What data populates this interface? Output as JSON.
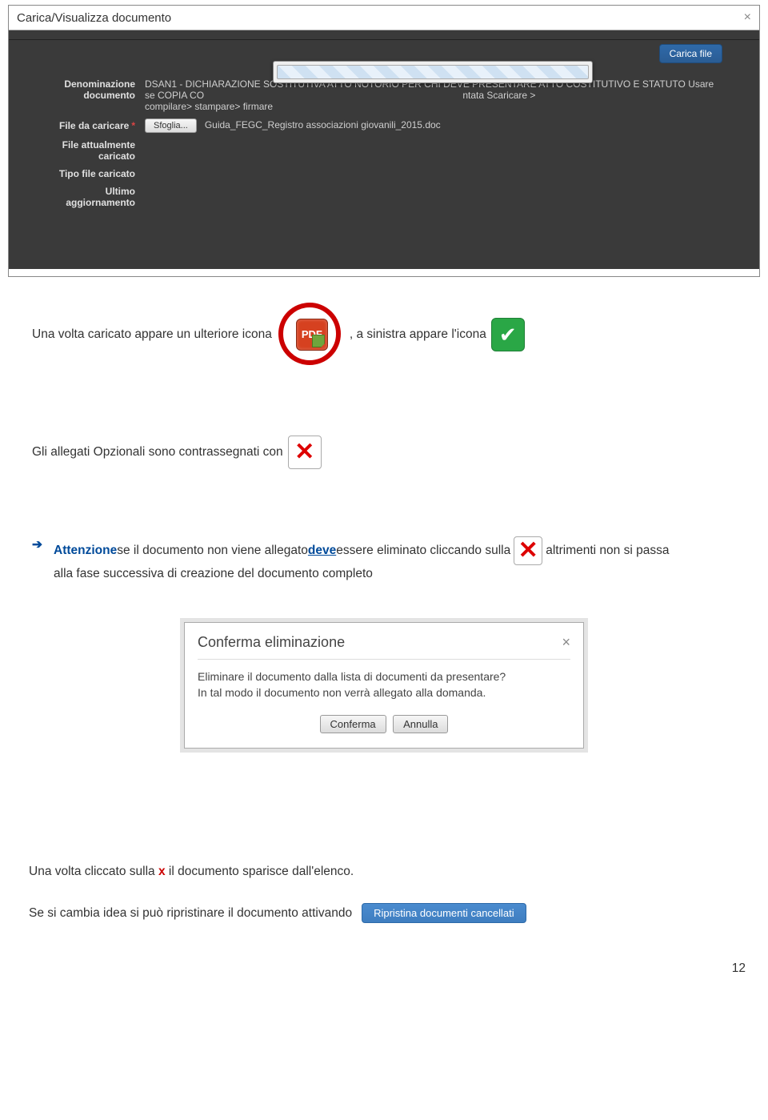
{
  "modal": {
    "title": "Carica/Visualizza documento",
    "close": "×",
    "upload_btn": "Carica file",
    "rows": {
      "name_label": "Denominazione documento",
      "name_value": "DSAN1 - DICHIARAZIONE SOSTITUTIVA ATTO NOTORIO PER CHI DEVE PRESENTARE ATTO COSTITUTIVO E STATUTO Usare se COPIA CO",
      "name_value2": "ntata Scaricare >",
      "name_value3": "compilare> stampare> firmare",
      "file_label": "File da caricare",
      "browse_btn": "Sfoglia...",
      "file_name": "Guida_FEGC_Registro associazioni giovanili_2015.doc",
      "current_label": "File attualmente caricato",
      "type_label": "Tipo file caricato",
      "updated_label": "Ultimo aggiornamento"
    }
  },
  "narrative": {
    "line1a": "Una volta caricato appare un ulteriore icona",
    "line1b": ",  a sinistra appare l'icona",
    "line2": "Gli allegati Opzionali sono contrassegnati  con",
    "attn_label": "Attenzione",
    "attn_a": " se il documento non viene allegato ",
    "attn_deve": "deve",
    "attn_b": " essere eliminato cliccando sulla ",
    "attn_c": " altrimenti non si passa",
    "attn_d": "alla fase successiva di creazione del documento completo",
    "pdf_label": "PDF",
    "check_symbol": "✔",
    "x_symbol": "✕"
  },
  "dialog": {
    "title": "Conferma eliminazione",
    "close": "×",
    "body1": "Eliminare il documento dalla lista di documenti da presentare?",
    "body2": "In tal modo il documento non verrà allegato alla domanda.",
    "confirm": "Conferma",
    "cancel": "Annulla"
  },
  "bottom": {
    "line_a1": "Una volta cliccato sulla ",
    "line_a_x": "x",
    "line_a2": " il documento sparisce dall'elenco.",
    "line_b": "Se si cambia idea si può ripristinare il documento attivando",
    "restore_btn": "Ripristina documenti cancellati"
  },
  "page_number": "12"
}
